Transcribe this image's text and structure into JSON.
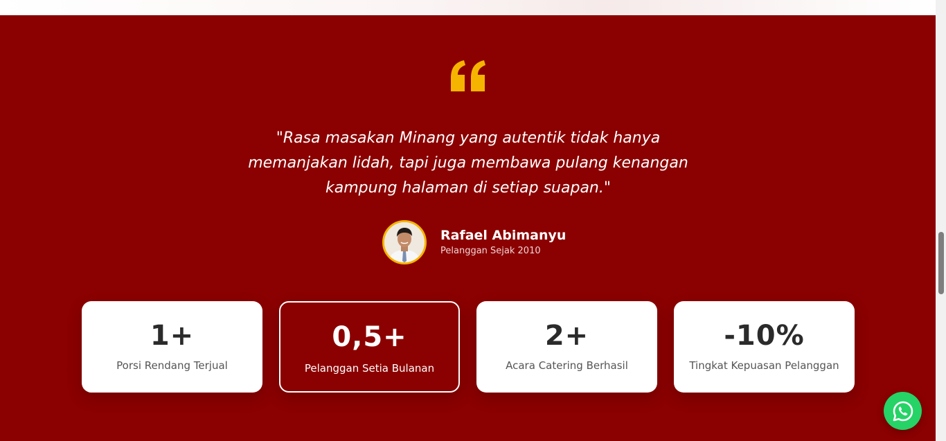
{
  "testimonial": {
    "quote": "\"Rasa masakan Minang yang autentik tidak hanya memanjakan lidah, tapi juga membawa pulang kenangan kampung halaman di setiap suapan.\"",
    "author_name": "Rafael Abimanyu",
    "author_subtitle": "Pelanggan Sejak 2010",
    "quote_icon": "quote-open-icon",
    "avatar": "customer-photo"
  },
  "stats": [
    {
      "value": "1+",
      "label": "Porsi Rendang Terjual",
      "highlighted": false
    },
    {
      "value": "0,5+",
      "label": "Pelanggan Setia Bulanan",
      "highlighted": true
    },
    {
      "value": "2+",
      "label": "Acara Catering Berhasil",
      "highlighted": false
    },
    {
      "value": "-10%",
      "label": "Tingkat Kepuasan Pelanggan",
      "highlighted": false
    }
  ],
  "floating": {
    "icon": "whatsapp-icon"
  },
  "colors": {
    "section_background": "#8b0000",
    "accent": "#f5b400",
    "whatsapp": "#25d366",
    "card": "#ffffff"
  }
}
